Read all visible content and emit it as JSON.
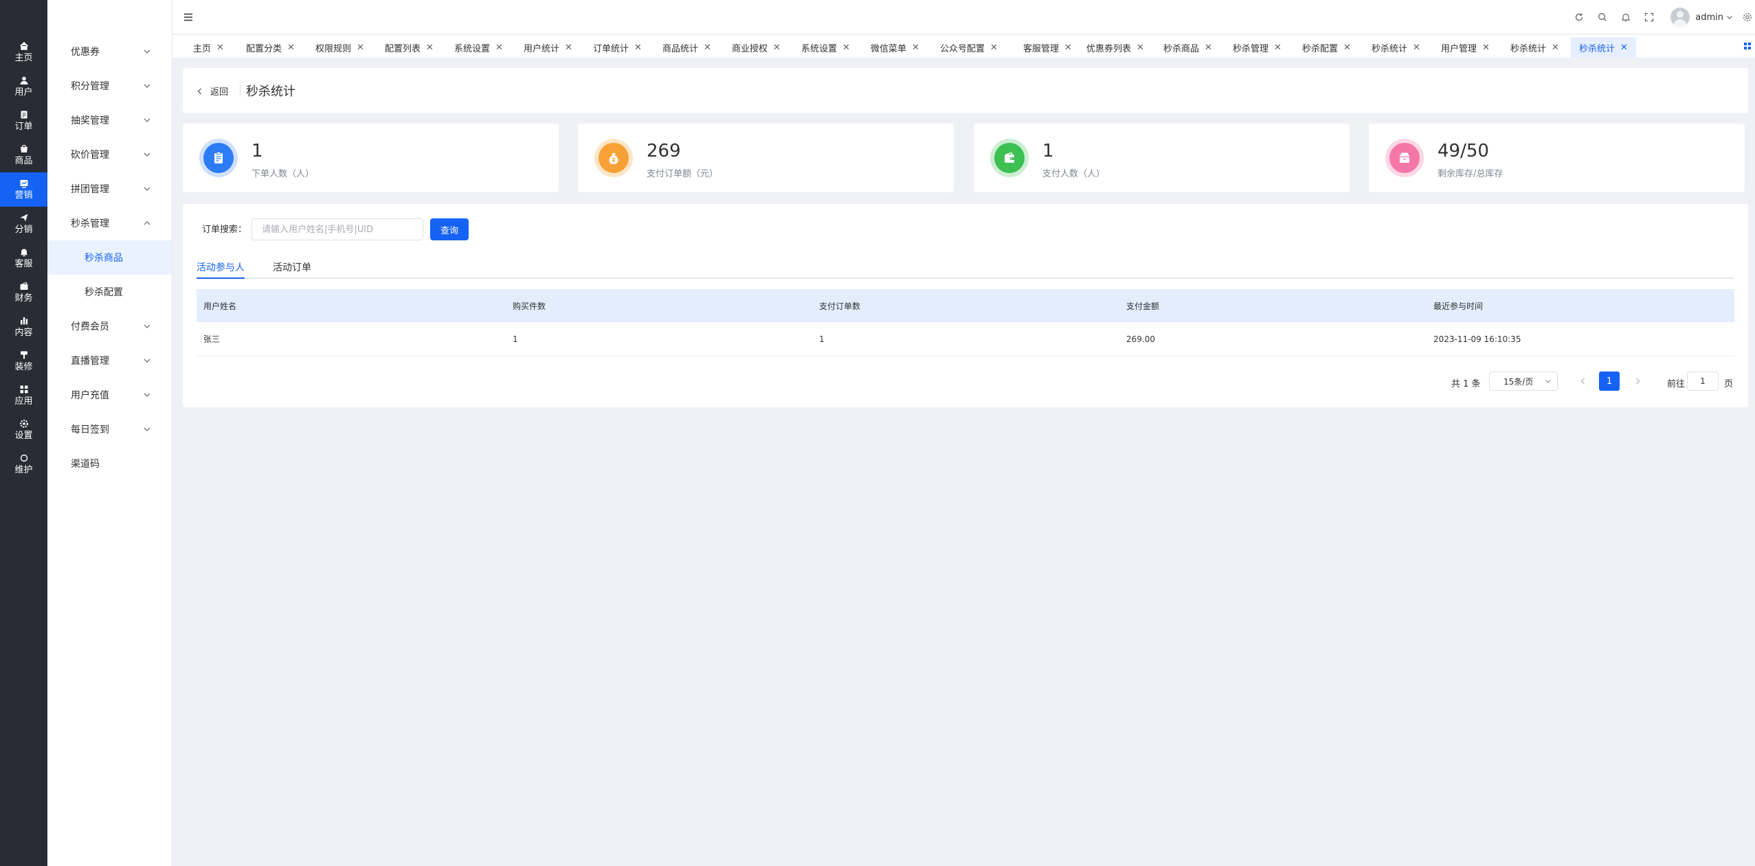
{
  "rail": {
    "items": [
      {
        "label": "主页",
        "icon": "home-icon"
      },
      {
        "label": "用户",
        "icon": "user-icon"
      },
      {
        "label": "订单",
        "icon": "order-icon"
      },
      {
        "label": "商品",
        "icon": "product-icon"
      },
      {
        "label": "营销",
        "icon": "marketing-icon"
      },
      {
        "label": "分销",
        "icon": "distribution-icon"
      },
      {
        "label": "客服",
        "icon": "service-icon"
      },
      {
        "label": "财务",
        "icon": "finance-icon"
      },
      {
        "label": "内容",
        "icon": "content-icon"
      },
      {
        "label": "装修",
        "icon": "decorate-icon"
      },
      {
        "label": "应用",
        "icon": "apps-icon"
      },
      {
        "label": "设置",
        "icon": "settings-icon"
      },
      {
        "label": "维护",
        "icon": "maintenance-icon"
      }
    ],
    "active_index": 4
  },
  "submenu": {
    "items": [
      {
        "label": "优惠券",
        "expandable": true
      },
      {
        "label": "积分管理",
        "expandable": true
      },
      {
        "label": "抽奖管理",
        "expandable": true
      },
      {
        "label": "砍价管理",
        "expandable": true
      },
      {
        "label": "拼团管理",
        "expandable": true
      },
      {
        "label": "秒杀管理",
        "expandable": true,
        "expanded": true
      },
      {
        "label": "秒杀商品",
        "child": true,
        "active": true
      },
      {
        "label": "秒杀配置",
        "child": true
      },
      {
        "label": "付费会员",
        "expandable": true
      },
      {
        "label": "直播管理",
        "expandable": true
      },
      {
        "label": "用户充值",
        "expandable": true
      },
      {
        "label": "每日签到",
        "expandable": true
      },
      {
        "label": "渠道码",
        "expandable": false
      }
    ]
  },
  "header": {
    "user_name": "admin"
  },
  "tabs": [
    {
      "label": "主页"
    },
    {
      "label": "配置分类"
    },
    {
      "label": "权限规则"
    },
    {
      "label": "配置列表"
    },
    {
      "label": "系统设置"
    },
    {
      "label": "用户统计"
    },
    {
      "label": "订单统计"
    },
    {
      "label": "商品统计"
    },
    {
      "label": "商业授权"
    },
    {
      "label": "系统设置"
    },
    {
      "label": "微信菜单"
    },
    {
      "label": "公众号配置"
    },
    {
      "label": "客服管理"
    },
    {
      "label": "优惠券列表"
    },
    {
      "label": "秒杀商品"
    },
    {
      "label": "秒杀管理"
    },
    {
      "label": "秒杀配置"
    },
    {
      "label": "秒杀统计"
    },
    {
      "label": "用户管理"
    },
    {
      "label": "秒杀统计"
    },
    {
      "label": "秒杀统计",
      "active": true
    }
  ],
  "page": {
    "back_label": "返回",
    "title": "秒杀统计"
  },
  "stats": [
    {
      "value": "1",
      "label": "下单人数（人）",
      "color": "#2d7cf6",
      "ring": "#cfe0fd",
      "icon": "clipboard-icon"
    },
    {
      "value": "269",
      "label": "支付订单额（元）",
      "color": "#f7a035",
      "ring": "#fde6c8",
      "icon": "money-bag-icon"
    },
    {
      "value": "1",
      "label": "支付人数（人）",
      "color": "#3cc051",
      "ring": "#cdeed3",
      "icon": "wallet-icon"
    },
    {
      "value": "49/50",
      "label": "剩余库存/总库存",
      "color": "#f577a8",
      "ring": "#fcd7e5",
      "icon": "box-icon"
    }
  ],
  "search": {
    "label": "订单搜索：",
    "placeholder": "请输入用户姓名|手机号|UID",
    "value": "",
    "button": "查询"
  },
  "content_tabs": [
    {
      "label": "活动参与人",
      "active": true
    },
    {
      "label": "活动订单"
    }
  ],
  "table": {
    "columns": [
      "用户姓名",
      "购买件数",
      "支付订单数",
      "支付金额",
      "最近参与时间"
    ],
    "rows": [
      [
        "张三",
        "1",
        "1",
        "269.00",
        "2023-11-09 16:10:35"
      ]
    ]
  },
  "pagination": {
    "total": "共 1 条",
    "page_size": "15条/页",
    "current": "1",
    "goto_label": "前往",
    "goto_value": "1",
    "page_suffix": "页"
  },
  "colors": {
    "primary": "#1562f5",
    "rail_bg": "#282c34",
    "page_bg": "#eff1f5"
  }
}
